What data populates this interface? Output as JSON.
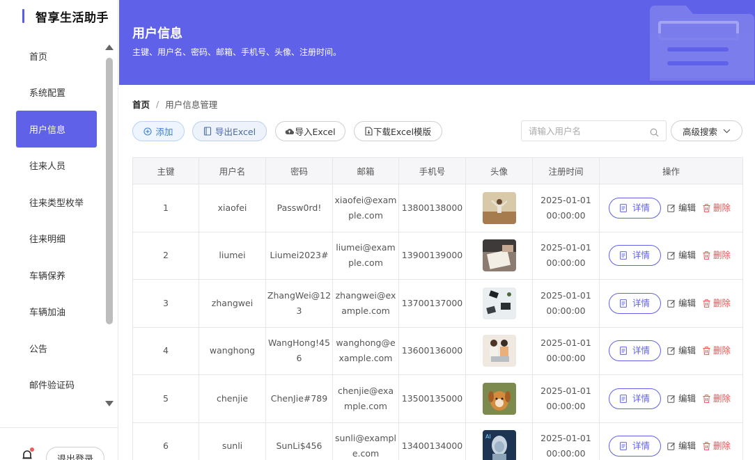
{
  "app": {
    "title": "智享生活助手",
    "brand_color": "#5f61e8"
  },
  "sidebar": {
    "items": [
      {
        "label": "首页",
        "active": false
      },
      {
        "label": "系统配置",
        "active": false
      },
      {
        "label": "用户信息",
        "active": true
      },
      {
        "label": "往来人员",
        "active": false
      },
      {
        "label": "往来类型枚举",
        "active": false
      },
      {
        "label": "往来明细",
        "active": false
      },
      {
        "label": "车辆保养",
        "active": false
      },
      {
        "label": "车辆加油",
        "active": false
      },
      {
        "label": "公告",
        "active": false
      },
      {
        "label": "邮件验证码",
        "active": false
      }
    ],
    "logout_label": "退出登录",
    "notification_icon": "bell-icon"
  },
  "header": {
    "title": "用户信息",
    "subtitle": "主键、用户名、密码、邮箱、手机号、头像、注册时间。"
  },
  "breadcrumb": {
    "home": "首页",
    "separator": "/",
    "current": "用户信息管理"
  },
  "toolbar": {
    "add_label": "添加",
    "export_label": "导出Excel",
    "import_label": "导入Excel",
    "template_label": "下载Excel模版",
    "search_placeholder": "请输入用户名",
    "advanced_label": "高级搜索"
  },
  "table": {
    "columns": [
      "主键",
      "用户名",
      "密码",
      "邮箱",
      "手机号",
      "头像",
      "注册时间",
      "操作"
    ],
    "action_labels": {
      "detail": "详情",
      "edit": "编辑",
      "delete": "删除"
    },
    "rows": [
      {
        "id": "1",
        "username": "xiaofei",
        "password": "Passw0rd!",
        "email": "xiaofei@example.com",
        "phone": "13800138000",
        "created": "2025-01-01 00:00:00",
        "avatar": "kid-outdoor"
      },
      {
        "id": "2",
        "username": "liumei",
        "password": "Liumei2023#",
        "email": "liumei@example.com",
        "phone": "13900139000",
        "created": "2025-01-01 00:00:00",
        "avatar": "reading-book"
      },
      {
        "id": "3",
        "username": "zhangwei",
        "password": "ZhangWei@123",
        "email": "zhangwei@example.com",
        "phone": "13700137000",
        "created": "2025-01-01 00:00:00",
        "avatar": "desk-items"
      },
      {
        "id": "4",
        "username": "wanghong",
        "password": "WangHong!456",
        "email": "wanghong@example.com",
        "phone": "13600136000",
        "created": "2025-01-01 00:00:00",
        "avatar": "couple-laptop"
      },
      {
        "id": "5",
        "username": "chenjie",
        "password": "ChenJie#789",
        "email": "chenjie@example.com",
        "phone": "13500135000",
        "created": "2025-01-01 00:00:00",
        "avatar": "puppy"
      },
      {
        "id": "6",
        "username": "sunli",
        "password": "SunLi$456",
        "email": "sunli@example.com",
        "phone": "13400134000",
        "created": "2025-01-01 00:00:00",
        "avatar": "ai-robot"
      }
    ]
  }
}
